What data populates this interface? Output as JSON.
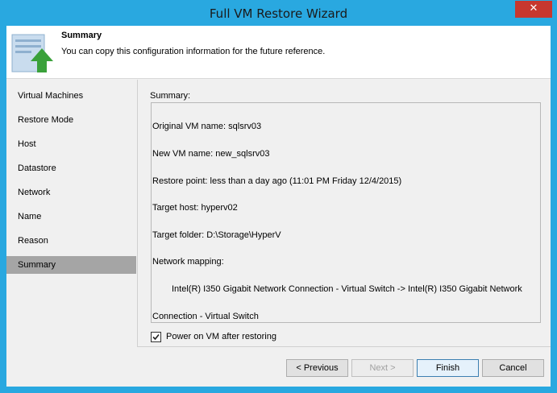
{
  "window": {
    "title": "Full VM Restore Wizard",
    "close_glyph": "✕"
  },
  "header": {
    "title": "Summary",
    "subtitle": "You can copy this configuration information for the future reference."
  },
  "nav": {
    "items": [
      {
        "label": "Virtual Machines",
        "active": false
      },
      {
        "label": "Restore Mode",
        "active": false
      },
      {
        "label": "Host",
        "active": false
      },
      {
        "label": "Datastore",
        "active": false
      },
      {
        "label": "Network",
        "active": false
      },
      {
        "label": "Name",
        "active": false
      },
      {
        "label": "Reason",
        "active": false
      },
      {
        "label": "Summary",
        "active": true
      }
    ]
  },
  "summary": {
    "label": "Summary:",
    "lines": [
      "Original VM name: sqlsrv03",
      "New VM name: new_sqlsrv03",
      "Restore point: less than a day ago (11:01 PM Friday 12/4/2015)",
      "Target host: hyperv02",
      "Target folder: D:\\Storage\\HyperV",
      "Network mapping:",
      "Intel(R) I350 Gigabit Network Connection - Virtual Switch -> Intel(R) I350 Gigabit Network",
      "Connection - Virtual Switch"
    ]
  },
  "options": {
    "power_on_label": "Power on VM after restoring",
    "power_on_checked": true
  },
  "buttons": {
    "previous": "< Previous",
    "next": "Next >",
    "finish": "Finish",
    "cancel": "Cancel"
  },
  "colors": {
    "titlebar": "#29a8e0",
    "close": "#c7372f",
    "nav_active": "#a5a5a5",
    "icon_arrow": "#3aa13a"
  }
}
